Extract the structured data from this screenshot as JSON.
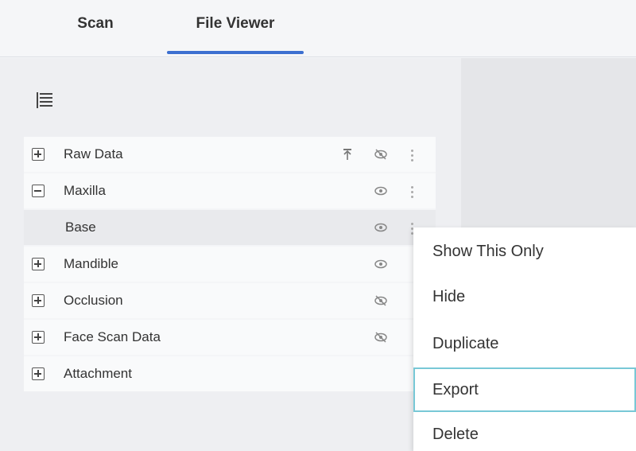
{
  "tabs": [
    {
      "label": "Scan"
    },
    {
      "label": "File Viewer",
      "active": true
    }
  ],
  "tree": {
    "rows": [
      {
        "label": "Raw Data",
        "expander": "plus",
        "icons": [
          "pin-icon",
          "eye-hidden-icon",
          "more-icon"
        ]
      },
      {
        "label": "Maxilla",
        "expander": "minus",
        "icons": [
          "eye-icon",
          "more-icon"
        ]
      },
      {
        "label": "Base",
        "expander": "none",
        "icons": [
          "eye-icon",
          "more-icon"
        ]
      },
      {
        "label": "Mandible",
        "expander": "plus",
        "icons": [
          "eye-icon"
        ]
      },
      {
        "label": "Occlusion",
        "expander": "plus",
        "icons": [
          "eye-hidden-icon"
        ]
      },
      {
        "label": "Face Scan Data",
        "expander": "plus",
        "icons": [
          "eye-hidden-icon"
        ]
      },
      {
        "label": "Attachment",
        "expander": "plus",
        "icons": []
      }
    ]
  },
  "context_menu": {
    "items": [
      {
        "label": "Show This Only"
      },
      {
        "label": "Hide"
      },
      {
        "label": "Duplicate"
      },
      {
        "label": "Export",
        "focused": true
      },
      {
        "label": "Delete"
      }
    ]
  },
  "colors": {
    "accent": "#3c6fd0",
    "focus_border": "#78c8d6"
  }
}
